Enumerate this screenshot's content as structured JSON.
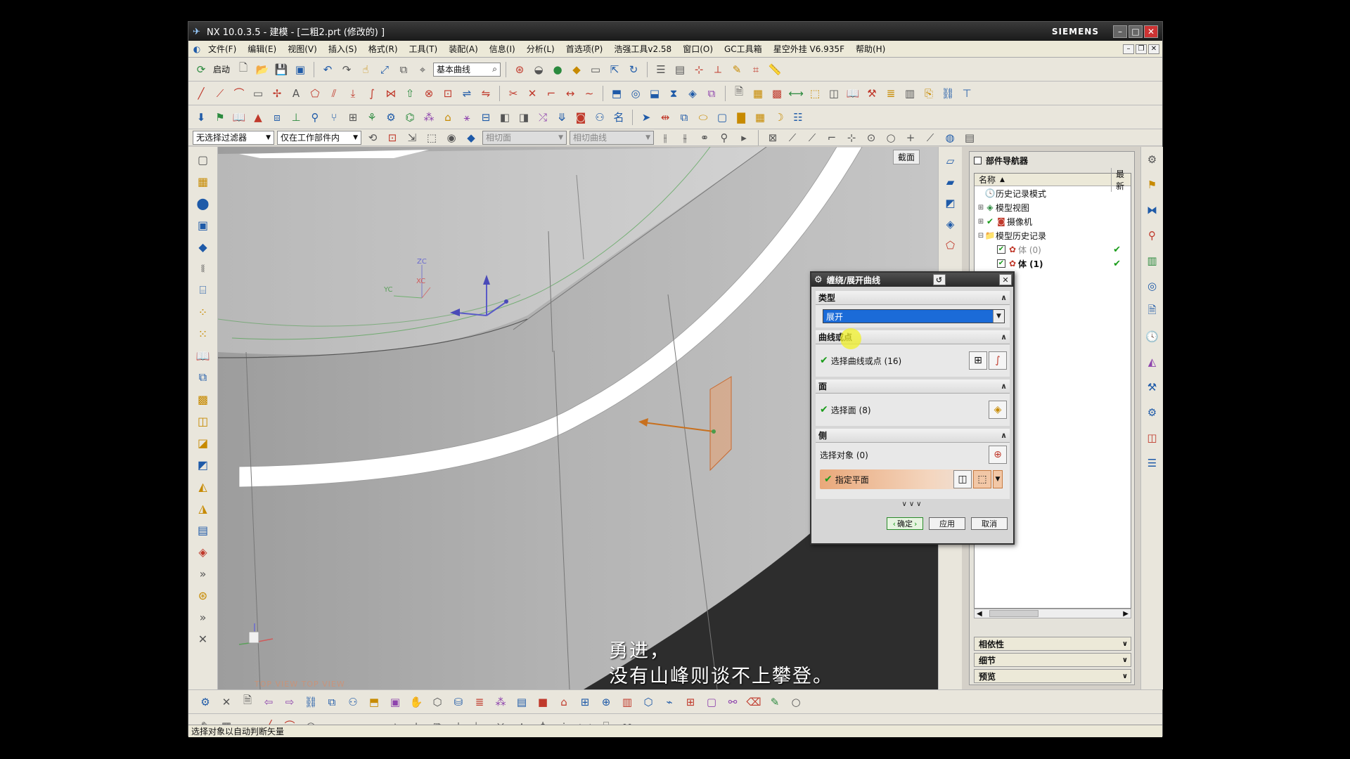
{
  "window": {
    "title": "NX 10.0.3.5 - 建模 - [二粗2.prt  (修改的) ]",
    "brand": "SIEMENS"
  },
  "menu": [
    "文件(F)",
    "编辑(E)",
    "视图(V)",
    "插入(S)",
    "格式(R)",
    "工具(T)",
    "装配(A)",
    "信息(I)",
    "分析(L)",
    "首选项(P)",
    "浩强工具v2.58",
    "窗口(O)",
    "GC工具箱",
    "星空外挂 V6.935F",
    "帮助(H)"
  ],
  "toolbar": {
    "start_label": "启动",
    "command_search_value": "基本曲线"
  },
  "filterbar": {
    "filter_value": "无选择过滤器",
    "scope_value": "仅在工作部件内",
    "face_rule_value": "相切面",
    "curve_rule_value": "相切曲线"
  },
  "viewport": {
    "section_label": "截面",
    "triad": {
      "zc": "ZC",
      "xc": "XC",
      "yc": "YC"
    },
    "view_label": "TOP VIEW    TOP VIEW",
    "subtitle_line1": "勇进，",
    "subtitle_line2": "没有山峰则谈不上攀登。"
  },
  "navigator": {
    "title": "部件导航器",
    "col_name": "名称",
    "col_recent": "最新",
    "items": [
      {
        "label": "历史记录模式",
        "icon": "clock-icon"
      },
      {
        "label": "模型视图",
        "icon": "views-icon"
      },
      {
        "label": "摄像机",
        "icon": "camera-icon"
      },
      {
        "label": "模型历史记录",
        "icon": "folder-icon"
      },
      {
        "label": "体 (0)",
        "icon": "body-icon"
      },
      {
        "label": "体 (1)",
        "icon": "body-icon"
      }
    ],
    "accordions": [
      "相依性",
      "细节",
      "预览"
    ]
  },
  "dialog": {
    "title": "缠绕/展开曲线",
    "type_section": "类型",
    "type_value": "展开",
    "curves_section": "曲线或点",
    "select_curves": "选择曲线或点 (16)",
    "face_section": "面",
    "select_face": "选择面 (8)",
    "plane_section": "侧",
    "select_object": "选择对象 (0)",
    "specify_plane": "指定平面",
    "ok_label": "确定",
    "apply_label": "应用",
    "cancel_label": "取消"
  },
  "status": {
    "text": "选择对象以自动判断矢量"
  },
  "colors": {
    "accent": "#1b6bd8",
    "highlight": "#e9a87a",
    "check": "#1a9c1a"
  }
}
